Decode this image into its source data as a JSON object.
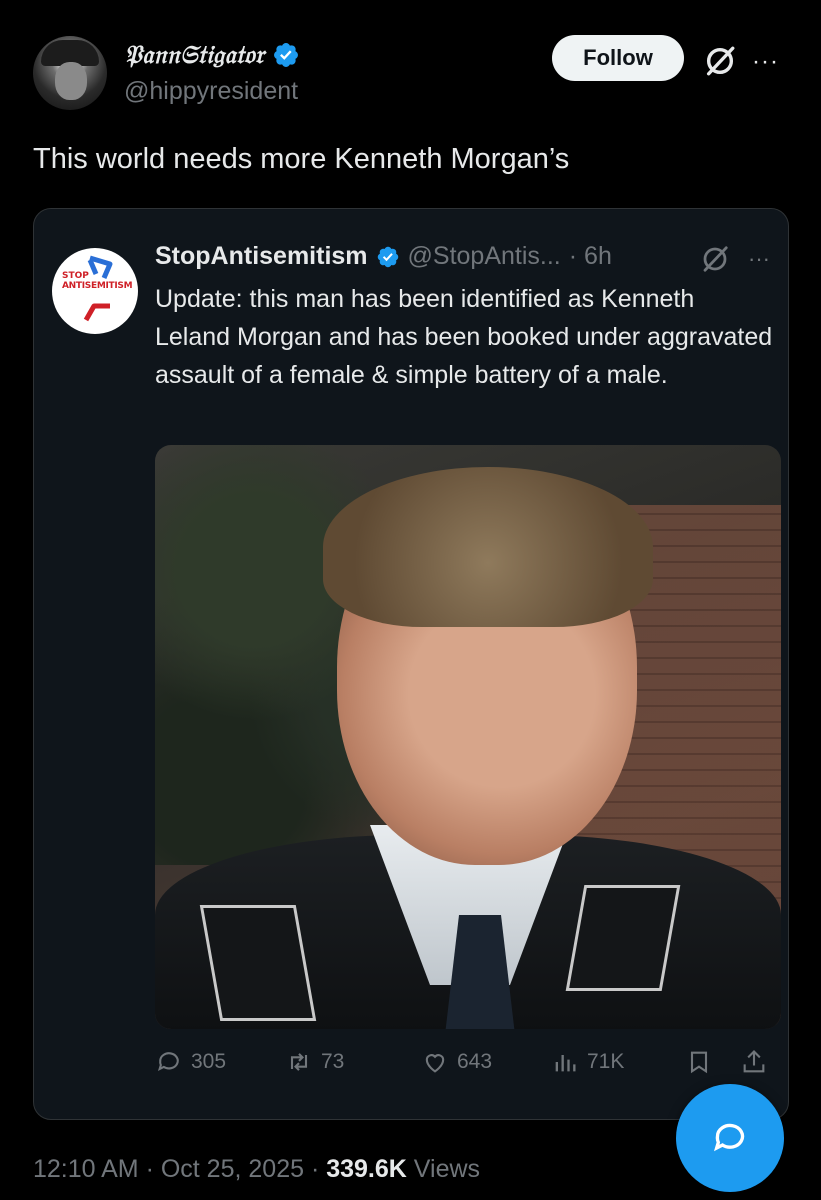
{
  "tweet": {
    "author": {
      "display_name": "𝔓𝔞𝔫𝔫𝔖𝔱𝔦𝔤𝔞𝔱𝔬𝔯",
      "handle": "@hippyresident",
      "verified": true
    },
    "follow_label": "Follow",
    "text": "This world needs more Kenneth Morgan’s",
    "timestamp": "12:10 AM · Oct 25, 2025 · ",
    "views_count": "339.6K",
    "views_label": " Views"
  },
  "quote": {
    "author": {
      "display_name": "StopAntisemitism",
      "handle": "@StopAntis...",
      "time": "· 6h",
      "verified": true,
      "avatar_text_top": "STOP",
      "avatar_text_bottom": "ANTISEMITISM"
    },
    "text": "Update: this man has been identified as Kenneth Leland Morgan and has been booked under aggravated assault of a female & simple battery of a male.",
    "metrics": {
      "replies": "305",
      "reposts": "73",
      "likes": "643",
      "views": "71K"
    }
  },
  "colors": {
    "accent": "#1d9bf0",
    "background": "#000000",
    "card_background": "#0f151b",
    "muted_text": "#71767b",
    "primary_text": "#e7e9ea"
  },
  "icons": [
    "verified-badge-icon",
    "grok-icon",
    "more-icon",
    "reply-icon",
    "repost-icon",
    "like-icon",
    "views-icon",
    "bookmark-icon",
    "share-icon",
    "compose-reply-icon"
  ]
}
